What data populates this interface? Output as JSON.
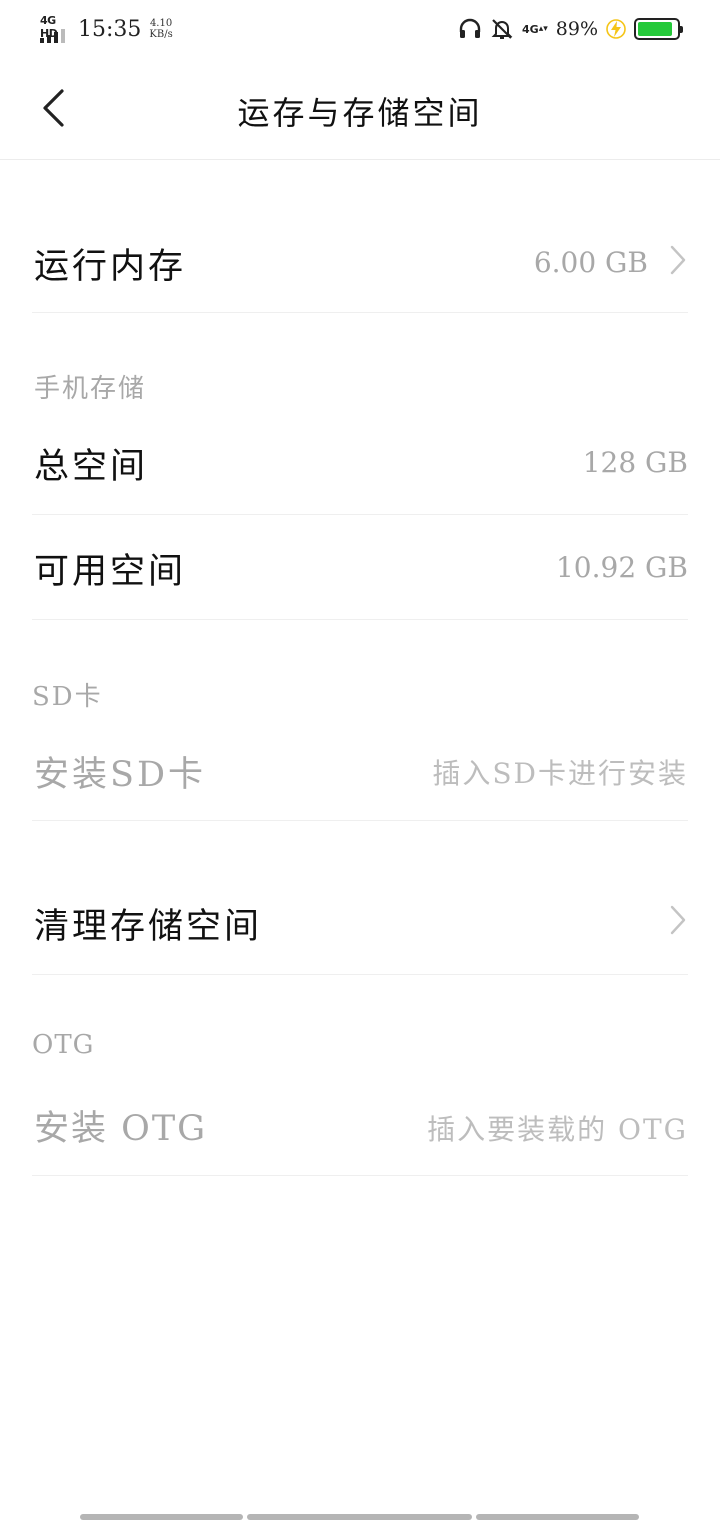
{
  "status_bar": {
    "network_type": "4G HD",
    "time": "15:35",
    "speed_value": "4.10",
    "speed_unit": "KB/s",
    "headset_icon": "headphones-icon",
    "mute_icon": "bell-off-icon",
    "data_indicator": "4G",
    "battery_percent": "89%",
    "battery_level": 0.89,
    "charging_icon": "lightning-icon",
    "battery_color": "#25c93a",
    "charging_color": "#f5c518"
  },
  "nav": {
    "back_icon": "chevron-left-icon",
    "title": "运存与存储空间"
  },
  "ram": {
    "label": "运行内存",
    "value": "6.00 GB"
  },
  "phone_storage": {
    "header": "手机存储",
    "total_label": "总空间",
    "total_value": "128 GB",
    "available_label": "可用空间",
    "available_value": "10.92 GB"
  },
  "sd_card": {
    "header": "SD卡",
    "install_label": "安装SD卡",
    "install_hint": "插入SD卡进行安装"
  },
  "clean": {
    "label": "清理存储空间"
  },
  "otg": {
    "header": "OTG",
    "install_label": "安装 OTG",
    "install_hint": "插入要装载的 OTG"
  }
}
